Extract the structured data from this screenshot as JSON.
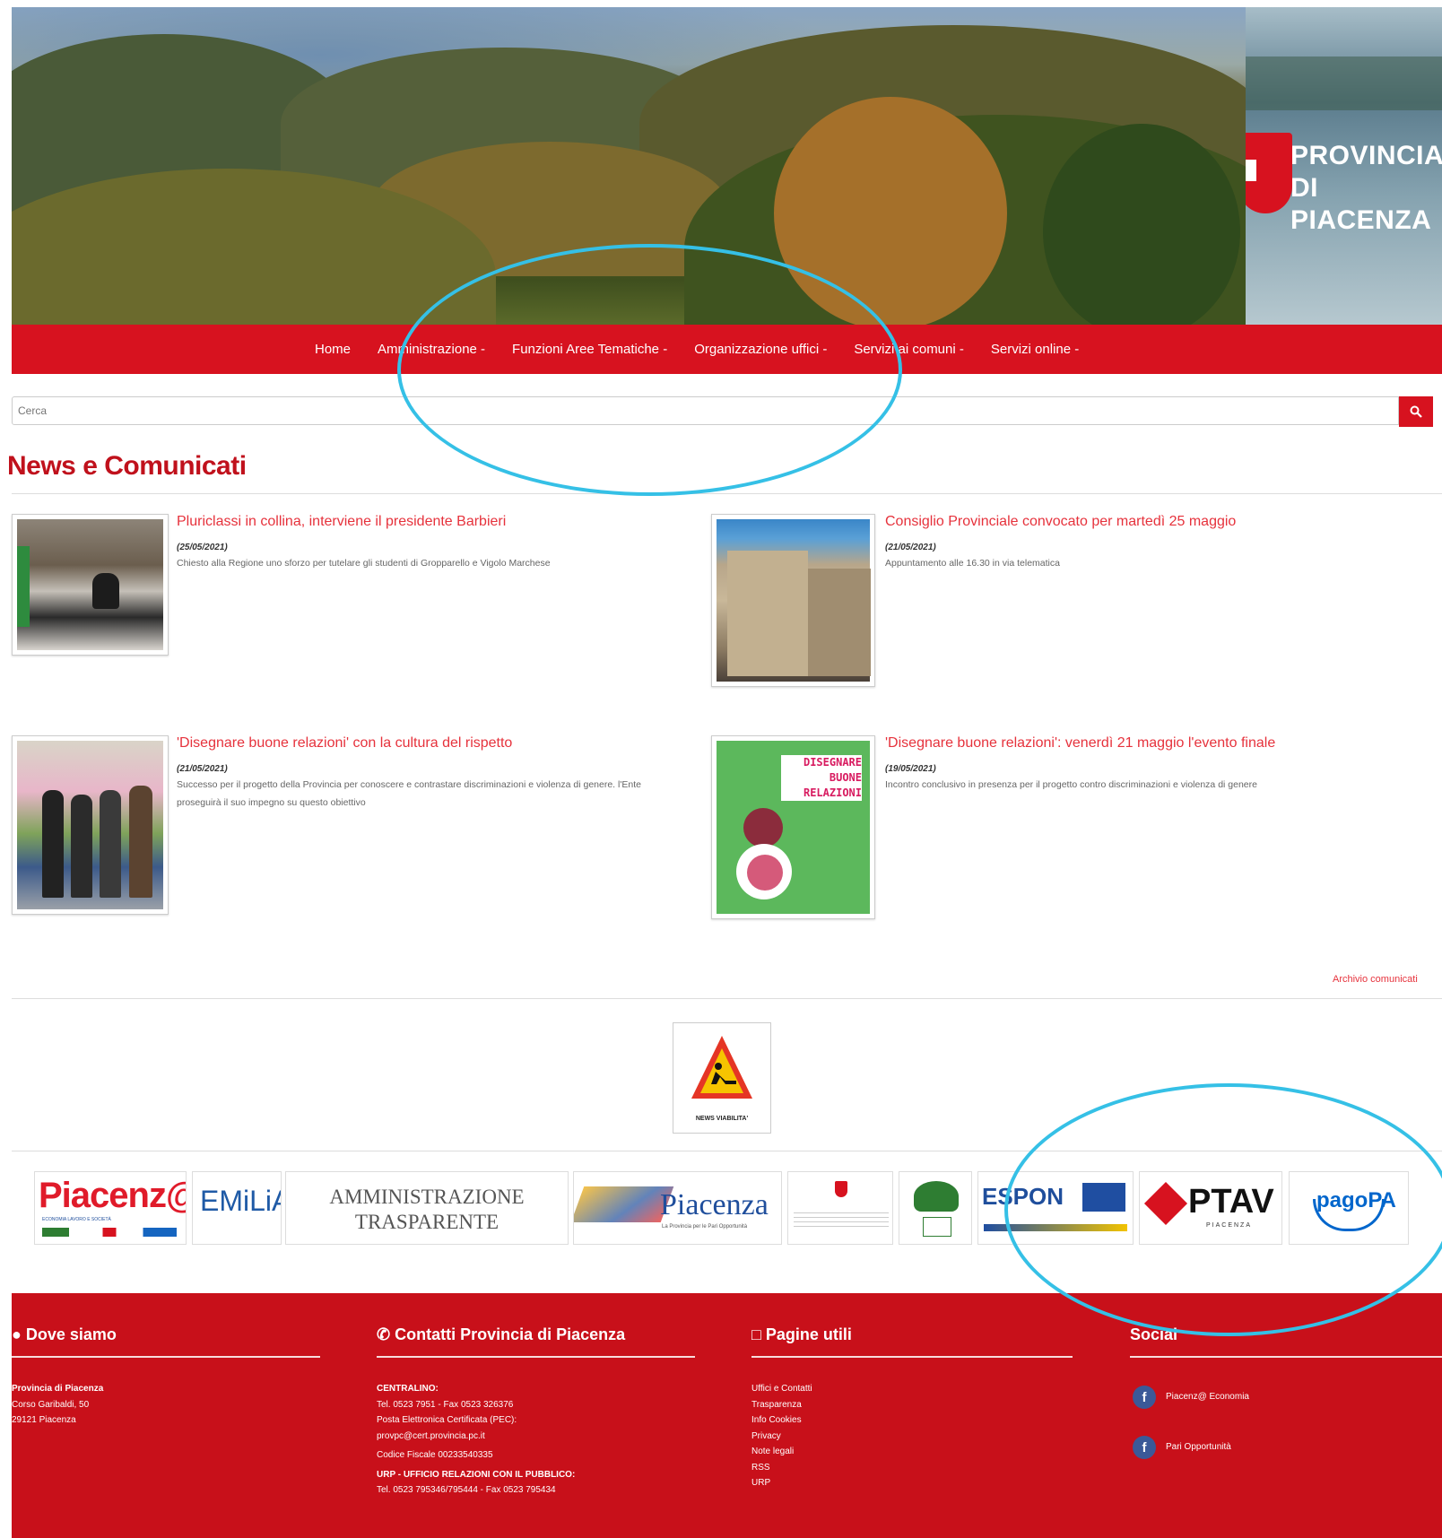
{
  "header": {
    "logo_text_line1": "PROVINCIA",
    "logo_text_line2": "DI PIACENZA",
    "brand_color": "#d7121f"
  },
  "nav": {
    "items": [
      {
        "label": "Home"
      },
      {
        "label": "Amministrazione -"
      },
      {
        "label": "Funzioni Aree Tematiche -"
      },
      {
        "label": "Organizzazione uffici -"
      },
      {
        "label": "Servizi ai comuni -"
      },
      {
        "label": "Servizi online -"
      }
    ]
  },
  "search": {
    "placeholder": "Cerca",
    "icon": "search-icon"
  },
  "news": {
    "section_title": "News e Comunicati",
    "items": [
      {
        "title": "Pluriclassi in collina, interviene il presidente Barbieri",
        "date": "(25/05/2021)",
        "excerpt": "Chiesto alla Regione uno sforzo per tutelare gli studenti di Gropparello e Vigolo Marchese"
      },
      {
        "title": "Consiglio Provinciale convocato per martedì 25 maggio",
        "date": "(21/05/2021)",
        "excerpt": "Appuntamento alle 16.30 in via telematica"
      },
      {
        "title": "'Disegnare buone relazioni' con la cultura del rispetto",
        "date": "(21/05/2021)",
        "excerpt": "Successo per il progetto della Provincia per conoscere e contrastare discriminazioni e violenza di genere. l'Ente proseguirà il suo impegno su questo obiettivo"
      },
      {
        "title": "'Disegnare buone relazioni': venerdì 21 maggio l'evento finale",
        "date": "(19/05/2021)",
        "excerpt": "Incontro conclusivo in presenza per il progetto contro discriminazioni e violenza di genere"
      }
    ],
    "poster_text": [
      "DISEGNARE",
      "BUONE",
      "RELAZIONI"
    ],
    "archive_label": "Archivio comunicati"
  },
  "viabilita": {
    "label": "NEWS VIABILITA'"
  },
  "banners": {
    "piacenza_economia": "Piacenz@",
    "piacenza_economia_sub": "ECONOMIA LAVORO E SOCIETÀ",
    "emilia": "EMiLiA",
    "amministrazione_line1": "AMMINISTRAZIONE",
    "amministrazione_line2": "TRASPARENTE",
    "piacenza_pari": "Piacenza",
    "piacenza_pari_sub": "La Provincia per le Pari Opportunità",
    "espon": "ESPON",
    "ptav": "PTAV",
    "ptav_sub": "PIACENZA",
    "pagopa": "pagoPA"
  },
  "footer": {
    "dove_siamo": {
      "heading": "Dove siamo",
      "lines": [
        "Provincia di Piacenza",
        "Corso Garibaldi, 50",
        "29121 Piacenza"
      ]
    },
    "contatti": {
      "heading": "Contatti Provincia di Piacenza",
      "centralino_label": "CENTRALINO:",
      "centralino_tel": "Tel. 0523 7951 - Fax 0523 326376",
      "pec_label": "Posta Elettronica Certificata (PEC):",
      "pec": "provpc@cert.provincia.pc.it",
      "codice_fiscale": "Codice Fiscale 00233540335",
      "urp_label": "URP - UFFICIO RELAZIONI CON IL PUBBLICO:",
      "urp_tel": "Tel. 0523 795346/795444 - Fax 0523 795434"
    },
    "pagine_utili": {
      "heading": "Pagine utili",
      "links": [
        "Uffici e Contatti",
        "Trasparenza",
        "Info Cookies",
        "Privacy",
        "Note legali",
        "RSS",
        "URP"
      ]
    },
    "social": {
      "heading": "Social",
      "links": [
        "Piacenz@ Economia",
        "Pari Opportunità"
      ]
    }
  },
  "annotations": {
    "color": "#35c0e6"
  }
}
